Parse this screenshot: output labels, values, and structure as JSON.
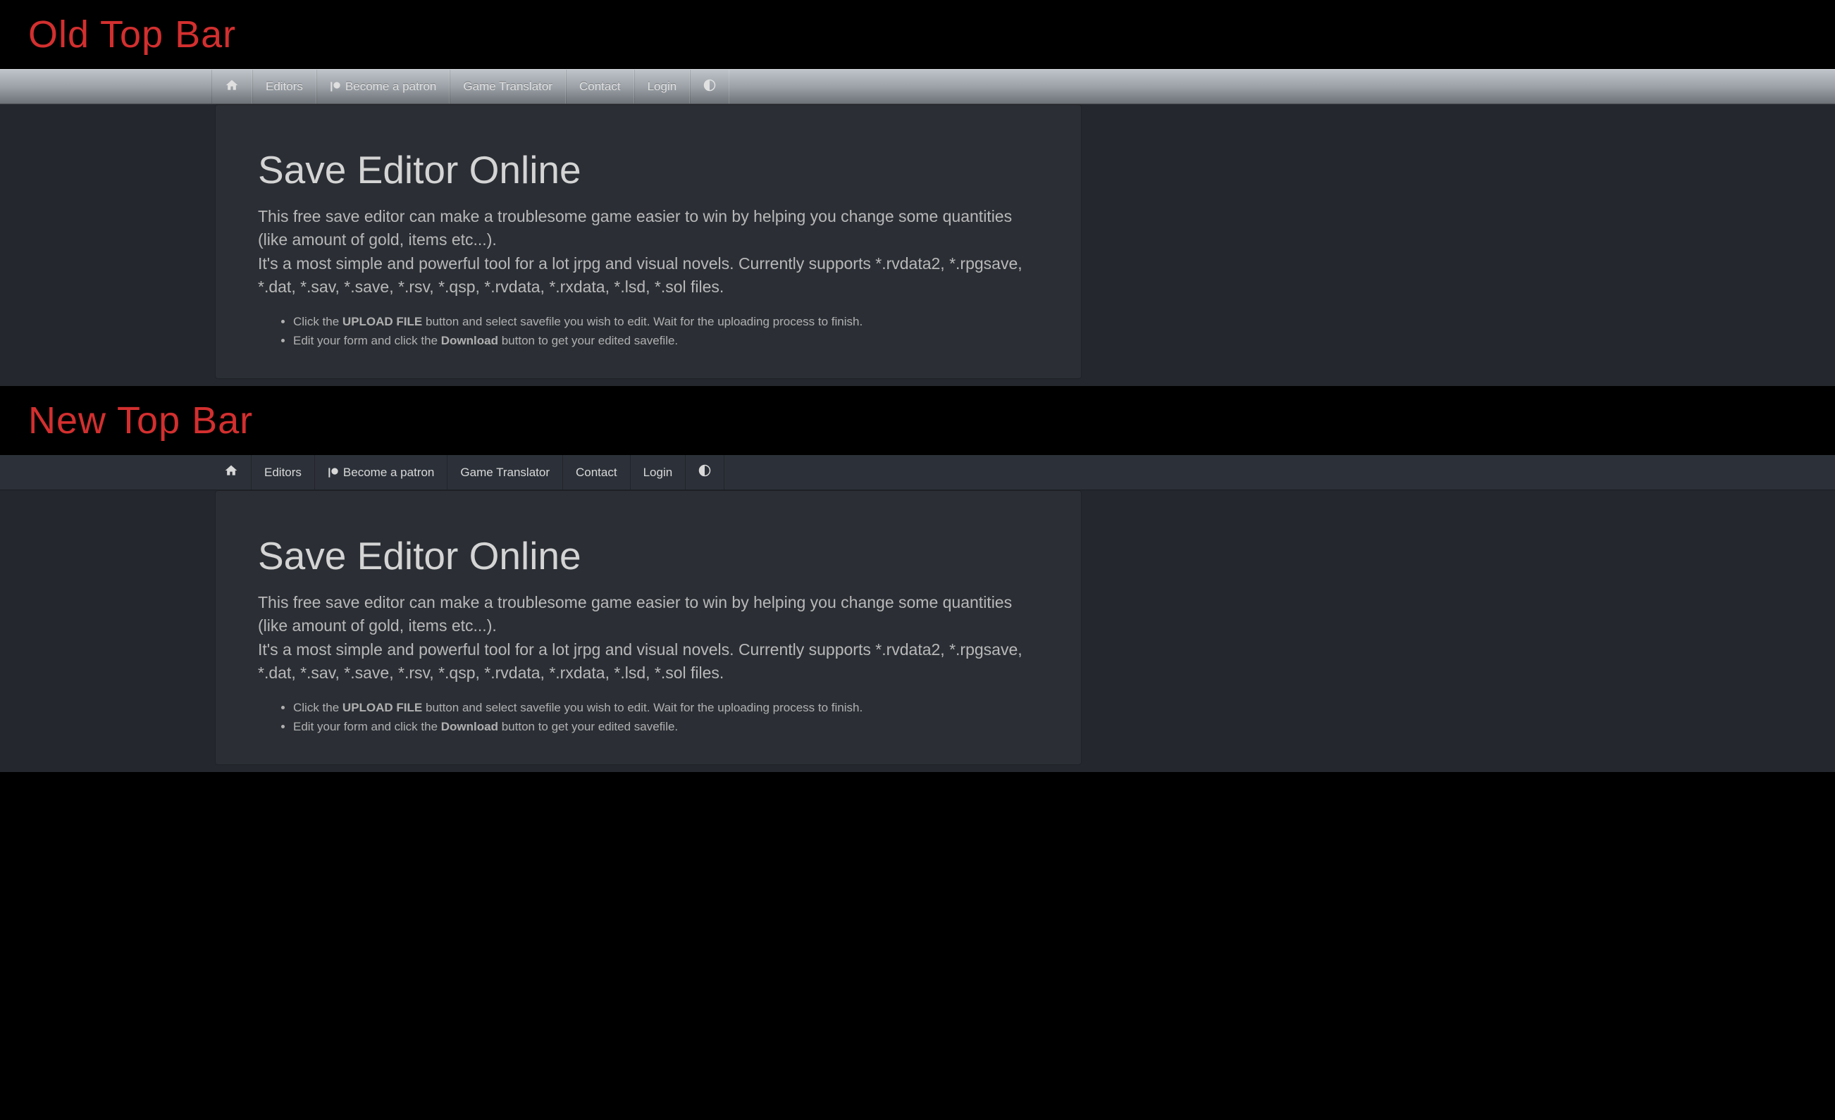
{
  "labels": {
    "old": "Old Top Bar",
    "new": "New Top Bar"
  },
  "nav": {
    "editors": "Editors",
    "become_patron": "Become a patron",
    "game_translator": "Game Translator",
    "contact": "Contact",
    "login": "Login"
  },
  "content": {
    "title": "Save Editor Online",
    "description_line1": "This free save editor can make a troublesome game easier to win by helping you change some quantities (like amount of gold, items etc...).",
    "description_line2": "It's a most simple and powerful tool for a lot jrpg and visual novels. Currently supports *.rvdata2, *.rpgsave, *.dat, *.sav, *.save, *.rsv, *.qsp, *.rvdata, *.rxdata, *.lsd, *.sol files.",
    "instruction1_pre": "Click the ",
    "instruction1_bold": "UPLOAD FILE",
    "instruction1_post": " button and select savefile you wish to edit. Wait for the uploading process to finish.",
    "instruction2_pre": "Edit your form and click the ",
    "instruction2_bold": "Download",
    "instruction2_post": " button to get your edited savefile."
  }
}
